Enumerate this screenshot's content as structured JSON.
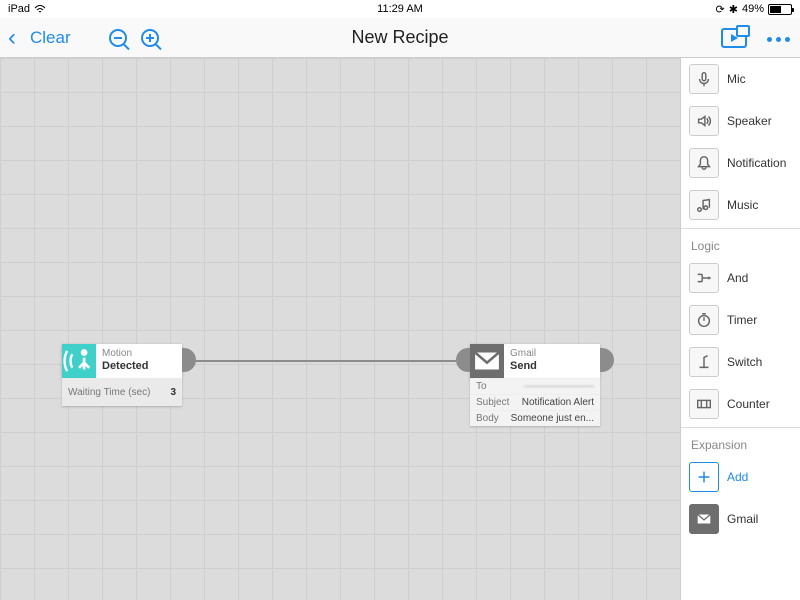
{
  "status": {
    "device": "iPad",
    "time": "11:29 AM",
    "battery_pct": "49%"
  },
  "toolbar": {
    "clear": "Clear",
    "title": "New Recipe"
  },
  "nodes": {
    "motion": {
      "category": "Motion",
      "action": "Detected",
      "wait_label": "Waiting Time (sec)",
      "wait_value": "3"
    },
    "gmail": {
      "category": "Gmail",
      "action": "Send",
      "to_label": "To",
      "to_value": "———————",
      "subject_label": "Subject",
      "subject_value": "Notification Alert",
      "body_label": "Body",
      "body_value": "Someone just en..."
    }
  },
  "panel": {
    "top": [
      {
        "label": "Mic"
      },
      {
        "label": "Speaker"
      },
      {
        "label": "Notification"
      },
      {
        "label": "Music"
      }
    ],
    "logic_title": "Logic",
    "logic": [
      {
        "label": "And"
      },
      {
        "label": "Timer"
      },
      {
        "label": "Switch"
      },
      {
        "label": "Counter"
      }
    ],
    "expansion_title": "Expansion",
    "expansion_add": "Add",
    "expansion_gmail": "Gmail"
  }
}
